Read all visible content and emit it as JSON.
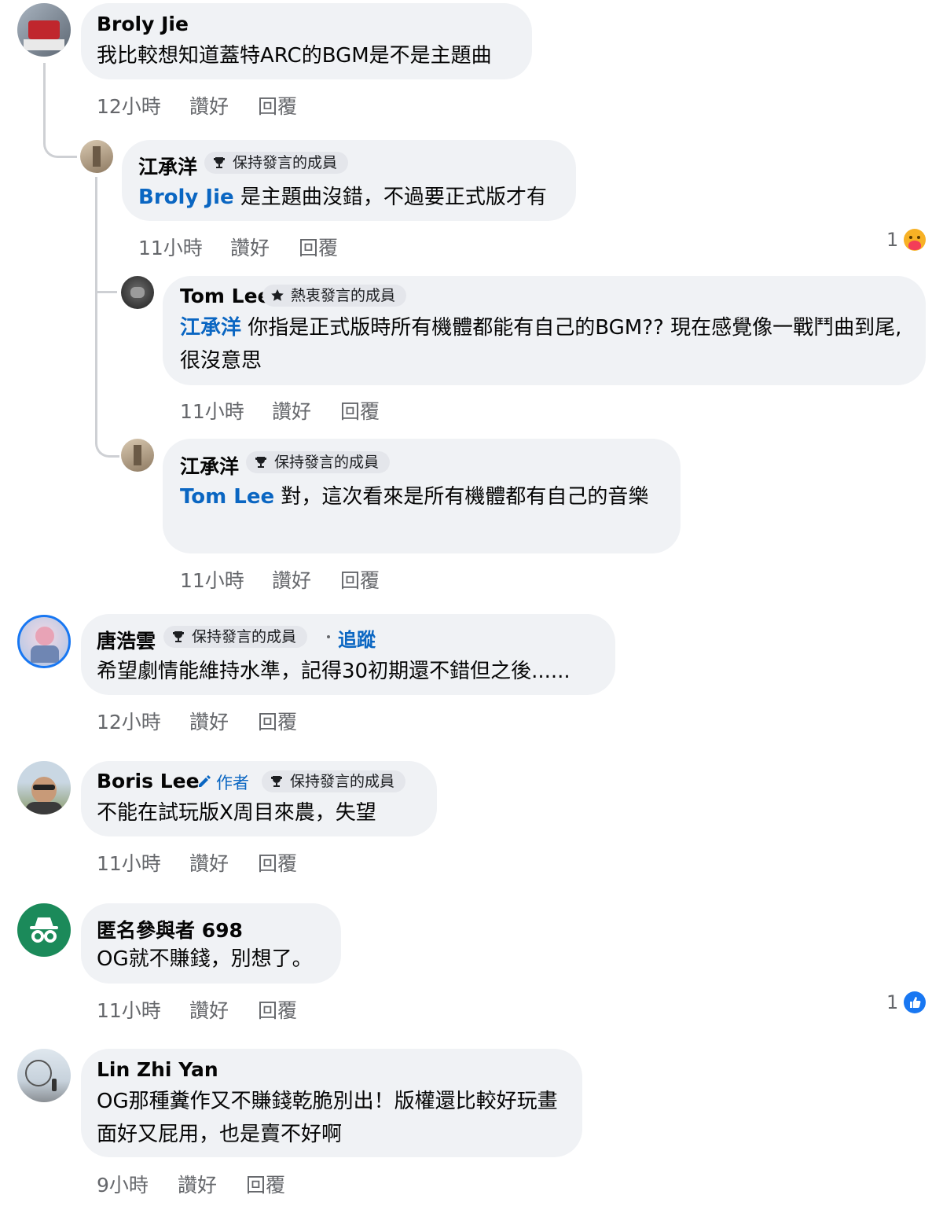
{
  "colors": {
    "bubble": "#f0f2f5",
    "mention": "#0a66c2",
    "meta": "#65676b",
    "like_blue": "#1877f2"
  },
  "actions": {
    "like": "讚好",
    "reply": "回覆"
  },
  "comments": [
    {
      "author": "Broly Jie",
      "text": "我比較想知道蓋特ARC的BGM是不是主題曲",
      "time": "12小時"
    },
    {
      "author": "江承洋",
      "badge": "保持發言的成員",
      "mention": "Broly Jie",
      "text": " 是主題曲沒錯，不過要正式版才有",
      "time": "11小時",
      "reaction_count": "1",
      "reaction_icon": "care-emoji-icon"
    },
    {
      "author": "Tom Lee",
      "badge": "熱衷發言的成員",
      "mention": "江承洋",
      "text": " 你指是正式版時所有機體都能有自己的BGM?? 現在感覺像一戰鬥曲到尾, 很沒意思",
      "time": "11小時"
    },
    {
      "author": "江承洋",
      "badge": "保持發言的成員",
      "mention": "Tom Lee",
      "text": " 對，這次看來是所有機體都有自己的音樂",
      "time": "11小時"
    },
    {
      "author": "唐浩雲",
      "badge": "保持發言的成員",
      "follow": "追蹤",
      "text": "希望劇情能維持水準，記得30初期還不錯但之後......",
      "time": "12小時"
    },
    {
      "author": "Boris Lee",
      "role": "作者",
      "badge": "保持發言的成員",
      "text": "不能在試玩版X周目來農，失望",
      "time": "11小時"
    },
    {
      "author": "匿名參與者 698",
      "text": "OG就不賺錢，別想了。",
      "time": "11小時",
      "reaction_count": "1",
      "reaction_icon": "like-icon"
    },
    {
      "author": "Lin Zhi Yan",
      "text": "OG那種糞作又不賺錢乾脆別出！版權還比較好玩畫面好又屁用，也是賣不好啊",
      "time": "9小時"
    }
  ]
}
